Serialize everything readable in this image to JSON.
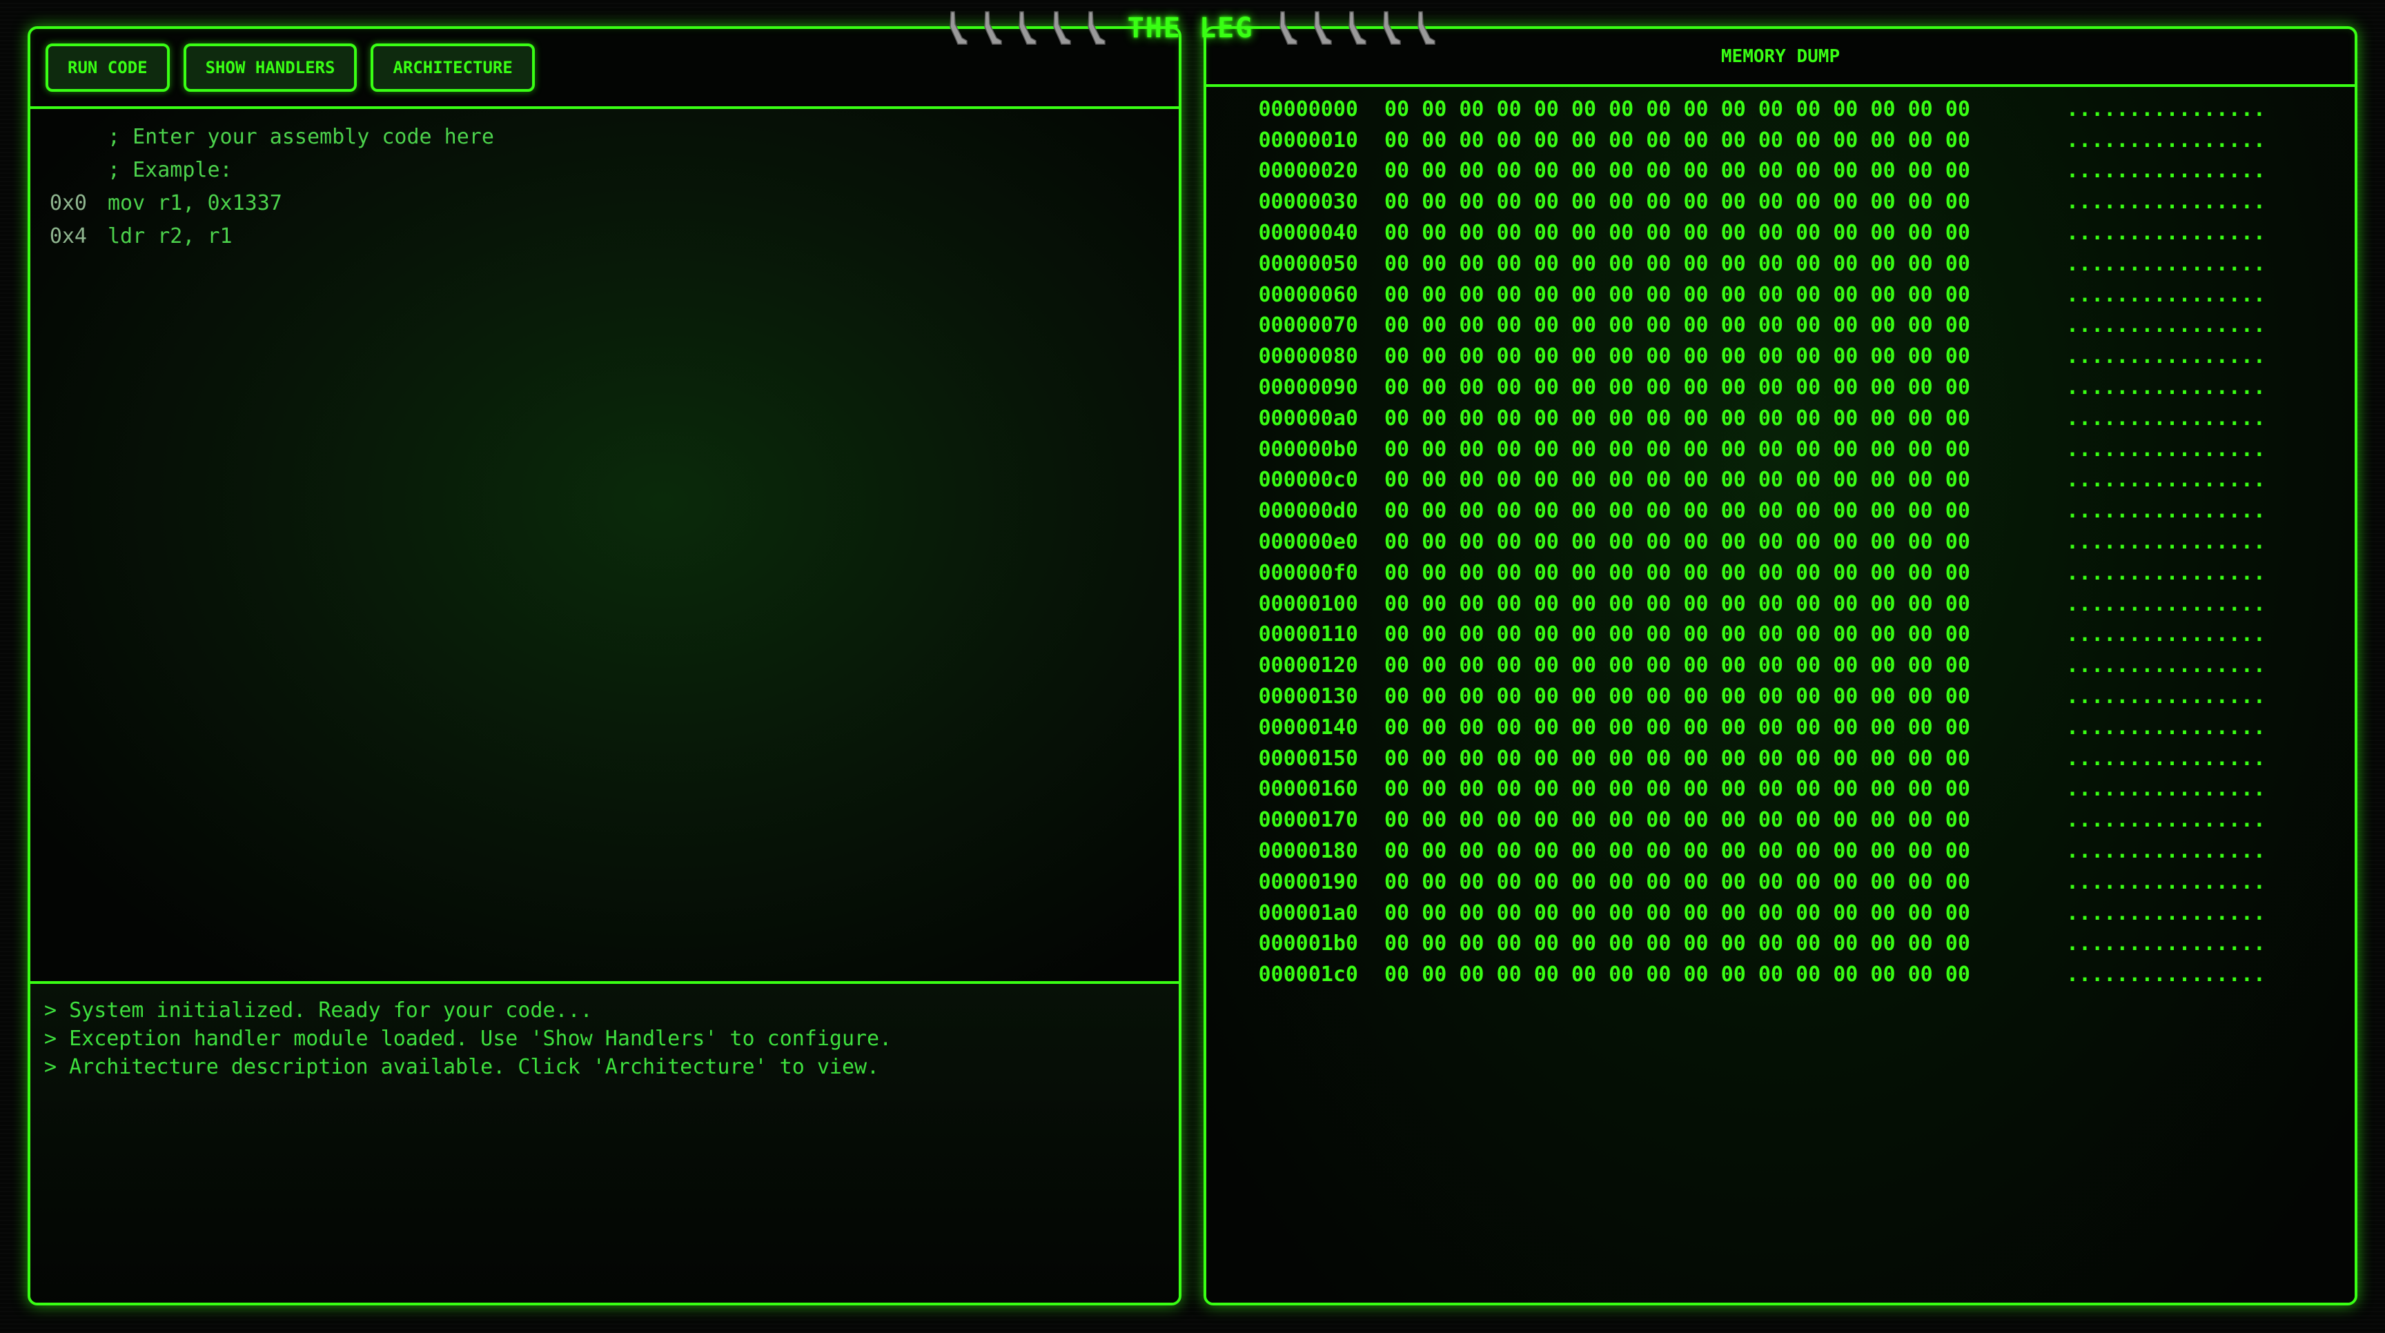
{
  "title": {
    "text": "THE LEG",
    "icon": "leg-icon",
    "left_icon_count": 5,
    "right_icon_count": 5
  },
  "colors": {
    "accent": "#39ff14",
    "background": "#050605",
    "button_bg": "#0e2a0e"
  },
  "toolbar": {
    "run_label": "RUN CODE",
    "handlers_label": "SHOW HANDLERS",
    "architecture_label": "ARCHITECTURE"
  },
  "editor": {
    "lines": [
      {
        "addr": "",
        "text": "; Enter your assembly code here"
      },
      {
        "addr": "",
        "text": "; Example:"
      },
      {
        "addr": "0x0",
        "text": "mov r1, 0x1337"
      },
      {
        "addr": "0x4",
        "text": "ldr r2, r1"
      }
    ]
  },
  "console": {
    "lines": [
      "> System initialized. Ready for your code...",
      "> Exception handler module loaded. Use 'Show Handlers' to configure.",
      "> Architecture description available. Click 'Architecture' to view."
    ]
  },
  "memory": {
    "title": "MEMORY DUMP",
    "rows": [
      {
        "addr": "00000000",
        "bytes": "00 00 00 00 00 00 00 00 00 00 00 00 00 00 00 00",
        "ascii": "................"
      },
      {
        "addr": "00000010",
        "bytes": "00 00 00 00 00 00 00 00 00 00 00 00 00 00 00 00",
        "ascii": "................"
      },
      {
        "addr": "00000020",
        "bytes": "00 00 00 00 00 00 00 00 00 00 00 00 00 00 00 00",
        "ascii": "................"
      },
      {
        "addr": "00000030",
        "bytes": "00 00 00 00 00 00 00 00 00 00 00 00 00 00 00 00",
        "ascii": "................"
      },
      {
        "addr": "00000040",
        "bytes": "00 00 00 00 00 00 00 00 00 00 00 00 00 00 00 00",
        "ascii": "................"
      },
      {
        "addr": "00000050",
        "bytes": "00 00 00 00 00 00 00 00 00 00 00 00 00 00 00 00",
        "ascii": "................"
      },
      {
        "addr": "00000060",
        "bytes": "00 00 00 00 00 00 00 00 00 00 00 00 00 00 00 00",
        "ascii": "................"
      },
      {
        "addr": "00000070",
        "bytes": "00 00 00 00 00 00 00 00 00 00 00 00 00 00 00 00",
        "ascii": "................"
      },
      {
        "addr": "00000080",
        "bytes": "00 00 00 00 00 00 00 00 00 00 00 00 00 00 00 00",
        "ascii": "................"
      },
      {
        "addr": "00000090",
        "bytes": "00 00 00 00 00 00 00 00 00 00 00 00 00 00 00 00",
        "ascii": "................"
      },
      {
        "addr": "000000a0",
        "bytes": "00 00 00 00 00 00 00 00 00 00 00 00 00 00 00 00",
        "ascii": "................"
      },
      {
        "addr": "000000b0",
        "bytes": "00 00 00 00 00 00 00 00 00 00 00 00 00 00 00 00",
        "ascii": "................"
      },
      {
        "addr": "000000c0",
        "bytes": "00 00 00 00 00 00 00 00 00 00 00 00 00 00 00 00",
        "ascii": "................"
      },
      {
        "addr": "000000d0",
        "bytes": "00 00 00 00 00 00 00 00 00 00 00 00 00 00 00 00",
        "ascii": "................"
      },
      {
        "addr": "000000e0",
        "bytes": "00 00 00 00 00 00 00 00 00 00 00 00 00 00 00 00",
        "ascii": "................"
      },
      {
        "addr": "000000f0",
        "bytes": "00 00 00 00 00 00 00 00 00 00 00 00 00 00 00 00",
        "ascii": "................"
      },
      {
        "addr": "00000100",
        "bytes": "00 00 00 00 00 00 00 00 00 00 00 00 00 00 00 00",
        "ascii": "................"
      },
      {
        "addr": "00000110",
        "bytes": "00 00 00 00 00 00 00 00 00 00 00 00 00 00 00 00",
        "ascii": "................"
      },
      {
        "addr": "00000120",
        "bytes": "00 00 00 00 00 00 00 00 00 00 00 00 00 00 00 00",
        "ascii": "................"
      },
      {
        "addr": "00000130",
        "bytes": "00 00 00 00 00 00 00 00 00 00 00 00 00 00 00 00",
        "ascii": "................"
      },
      {
        "addr": "00000140",
        "bytes": "00 00 00 00 00 00 00 00 00 00 00 00 00 00 00 00",
        "ascii": "................"
      },
      {
        "addr": "00000150",
        "bytes": "00 00 00 00 00 00 00 00 00 00 00 00 00 00 00 00",
        "ascii": "................"
      },
      {
        "addr": "00000160",
        "bytes": "00 00 00 00 00 00 00 00 00 00 00 00 00 00 00 00",
        "ascii": "................"
      },
      {
        "addr": "00000170",
        "bytes": "00 00 00 00 00 00 00 00 00 00 00 00 00 00 00 00",
        "ascii": "................"
      },
      {
        "addr": "00000180",
        "bytes": "00 00 00 00 00 00 00 00 00 00 00 00 00 00 00 00",
        "ascii": "................"
      },
      {
        "addr": "00000190",
        "bytes": "00 00 00 00 00 00 00 00 00 00 00 00 00 00 00 00",
        "ascii": "................"
      },
      {
        "addr": "000001a0",
        "bytes": "00 00 00 00 00 00 00 00 00 00 00 00 00 00 00 00",
        "ascii": "................"
      },
      {
        "addr": "000001b0",
        "bytes": "00 00 00 00 00 00 00 00 00 00 00 00 00 00 00 00",
        "ascii": "................"
      },
      {
        "addr": "000001c0",
        "bytes": "00 00 00 00 00 00 00 00 00 00 00 00 00 00 00 00",
        "ascii": "................"
      }
    ]
  }
}
